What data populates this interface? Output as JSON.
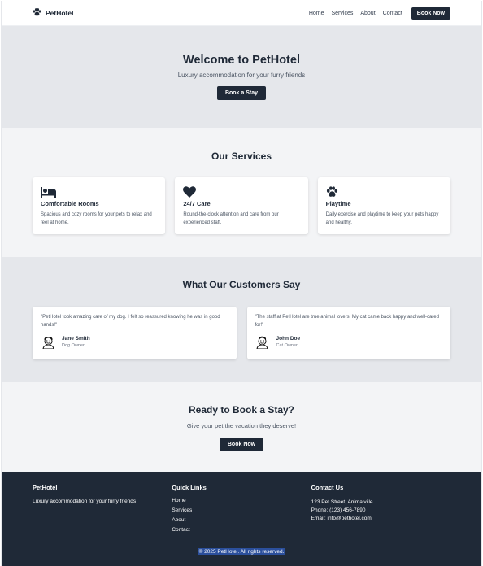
{
  "colors": {
    "primary": "#1f2937",
    "hero_bg": "#e5e7eb",
    "section_bg": "#f3f4f6",
    "selection": "#2b4f9c"
  },
  "nav": {
    "brand": "PetHotel",
    "brand_icon": "paw-icon",
    "links": [
      "Home",
      "Services",
      "About",
      "Contact"
    ],
    "cta": "Book Now"
  },
  "hero": {
    "title": "Welcome to PetHotel",
    "subtitle": "Luxury accommodation for your furry friends",
    "button": "Book a Stay"
  },
  "services": {
    "title": "Our Services",
    "items": [
      {
        "icon": "bed-icon",
        "title": "Comfortable Rooms",
        "text": "Spacious and cozy rooms for your pets to relax and feel at home."
      },
      {
        "icon": "heart-icon",
        "title": "24/7 Care",
        "text": "Round-the-clock attention and care from our experienced staff."
      },
      {
        "icon": "paw-icon",
        "title": "Playtime",
        "text": "Daily exercise and playtime to keep your pets happy and healthy."
      }
    ]
  },
  "testimonials": {
    "title": "What Our Customers Say",
    "items": [
      {
        "quote": "\"PetHotel took amazing care of my dog. I felt so reassured knowing he was in good hands!\"",
        "name": "Jane Smith",
        "role": "Dog Owner"
      },
      {
        "quote": "\"The staff at PetHotel are true animal lovers. My cat came back happy and well-cared for!\"",
        "name": "John Doe",
        "role": "Cat Owner"
      }
    ]
  },
  "cta": {
    "title": "Ready to Book a Stay?",
    "subtitle": "Give your pet the vacation they deserve!",
    "button": "Book Now"
  },
  "footer": {
    "brand": "PetHotel",
    "tagline": "Luxury accommodation for your furry friends",
    "quick_links_title": "Quick Links",
    "links": [
      "Home",
      "Services",
      "About",
      "Contact"
    ],
    "contact_title": "Contact Us",
    "address": "123 Pet Street, Animalville",
    "phone": "Phone: (123) 456-7890",
    "email": "Email: info@pethotel.com",
    "copyright": "© 2025 PetHotel. All rights reserved."
  }
}
